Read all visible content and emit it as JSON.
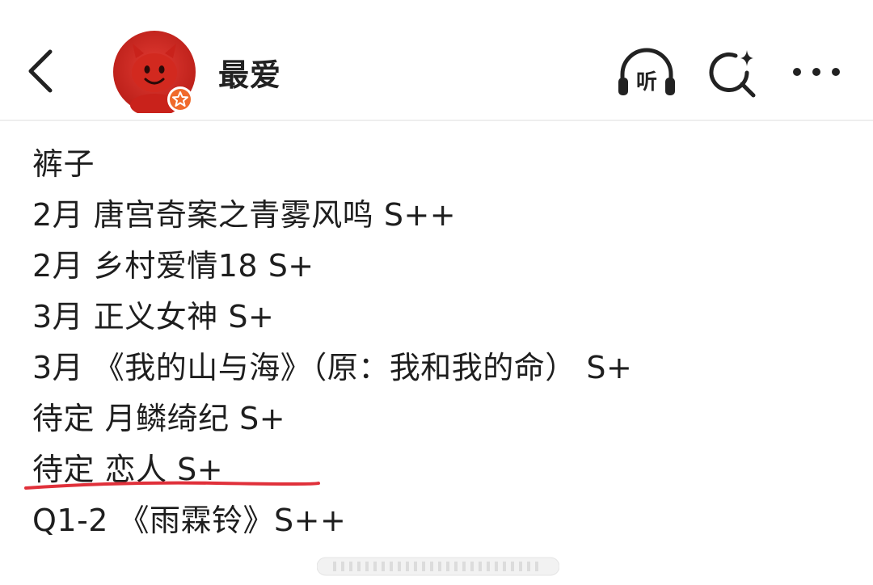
{
  "header": {
    "title": "最爱",
    "back_icon": "chevron-left-icon",
    "listen_label": "听",
    "search_icon": "sparkle-search-icon",
    "more_icon": "more-dots-icon",
    "avatar_icon": "red-devil-avatar",
    "badge_icon": "star-badge-icon",
    "accent_color": "#d9261c"
  },
  "post": {
    "lines": [
      "裤子",
      "2月 唐宫奇案之青雾风鸣 S++",
      "2月 乡村爱情18 S+",
      "3月 正义女神 S+",
      "3月 《我的山与海》（原：我和我的命） S+",
      "待定 月鳞绮纪 S+",
      "待定 恋人 S+",
      "Q1-2 《雨霖铃》S++"
    ],
    "highlight_line_index": 6,
    "highlight_color": "#e0303a"
  }
}
